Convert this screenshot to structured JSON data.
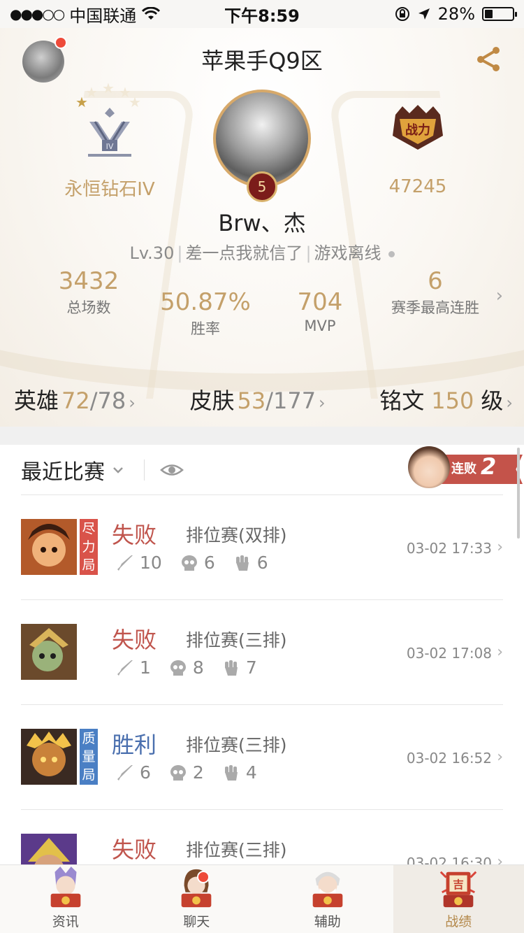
{
  "status_bar": {
    "signal": "●●●○○",
    "carrier": "中国联通",
    "time": "下午8:59",
    "battery_percent": "28%",
    "battery_level": 0.28
  },
  "header": {
    "server_name": "苹果手Q9区"
  },
  "profile": {
    "rank_name": "永恒钻石IV",
    "rank_stars_filled": 1,
    "rank_stars_total": 5,
    "level_badge": "5",
    "power_score": "47245",
    "player_name": "Brw、杰",
    "level": "Lv.30",
    "signature": "差一点我就信了",
    "online_status": "游戏离线"
  },
  "stats": {
    "total_games": {
      "value": "3432",
      "label": "总场数"
    },
    "win_rate": {
      "value": "50.87%",
      "label": "胜率"
    },
    "mvp": {
      "value": "704",
      "label": "MVP"
    },
    "best_streak": {
      "value": "6",
      "label": "赛季最高连胜"
    }
  },
  "counts": {
    "heroes": {
      "label": "英雄",
      "owned": "72",
      "total": "/78"
    },
    "skins": {
      "label": "皮肤",
      "owned": "53",
      "total": "/177"
    },
    "inscription": {
      "label": "铭文",
      "value": "150",
      "unit": "级"
    }
  },
  "recent": {
    "title": "最近比赛",
    "streak_label": "连败",
    "streak_count": "2",
    "matches": [
      {
        "result": "失败",
        "mode": "排位赛(双排)",
        "kills": "10",
        "deaths": "6",
        "assists": "6",
        "time": "03-02 17:33",
        "tag": "尽力局"
      },
      {
        "result": "失败",
        "mode": "排位赛(三排)",
        "kills": "1",
        "deaths": "8",
        "assists": "7",
        "time": "03-02 17:08",
        "tag": ""
      },
      {
        "result": "胜利",
        "mode": "排位赛(三排)",
        "kills": "6",
        "deaths": "2",
        "assists": "4",
        "time": "03-02 16:52",
        "tag": "质量局"
      },
      {
        "result": "失败",
        "mode": "排位赛(三排)",
        "time": "03-02 16:30"
      }
    ]
  },
  "tabs": [
    {
      "label": "资讯",
      "active": false
    },
    {
      "label": "聊天",
      "active": false
    },
    {
      "label": "辅助",
      "active": false
    },
    {
      "label": "战绩",
      "active": true
    }
  ],
  "colors": {
    "gold": "#c4a06a",
    "lose": "#c0554d",
    "win": "#4a6fae",
    "badge_red": "#ee4b3a"
  }
}
